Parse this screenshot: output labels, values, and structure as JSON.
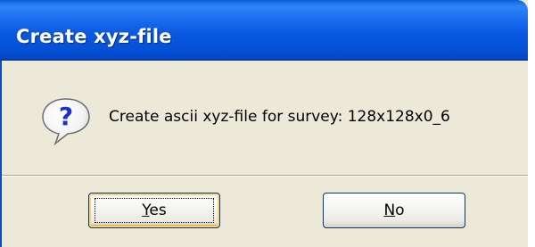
{
  "window": {
    "title": "Create xyz-file"
  },
  "dialog": {
    "icon": "question-icon",
    "message": "Create ascii xyz-file for survey:  128x128x0_6"
  },
  "buttons": {
    "yes": {
      "mnemonic": "Y",
      "rest": "es"
    },
    "no": {
      "mnemonic": "N",
      "rest": "o"
    }
  },
  "colors": {
    "titlebar": "#0a58e0",
    "face": "#ece9d8",
    "icon_blue": "#1a2fd0"
  }
}
